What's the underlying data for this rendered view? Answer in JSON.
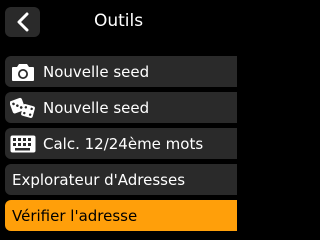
{
  "header": {
    "title": "Outils",
    "back_icon": "chevron-left-icon"
  },
  "menu": {
    "items": [
      {
        "label": "Nouvelle seed",
        "icon": "camera-icon"
      },
      {
        "label": "Nouvelle seed",
        "icon": "dice-icon"
      },
      {
        "label": "Calc. 12/24ème mots",
        "icon": "keyboard-icon"
      },
      {
        "label": "Explorateur d'Adresses",
        "icon": ""
      },
      {
        "label": "Vérifier l'adresse",
        "icon": "",
        "selected": true
      }
    ]
  },
  "colors": {
    "background": "#000000",
    "button": "#2a2a2a",
    "accent": "#ff9f0a",
    "text": "#ffffff"
  }
}
